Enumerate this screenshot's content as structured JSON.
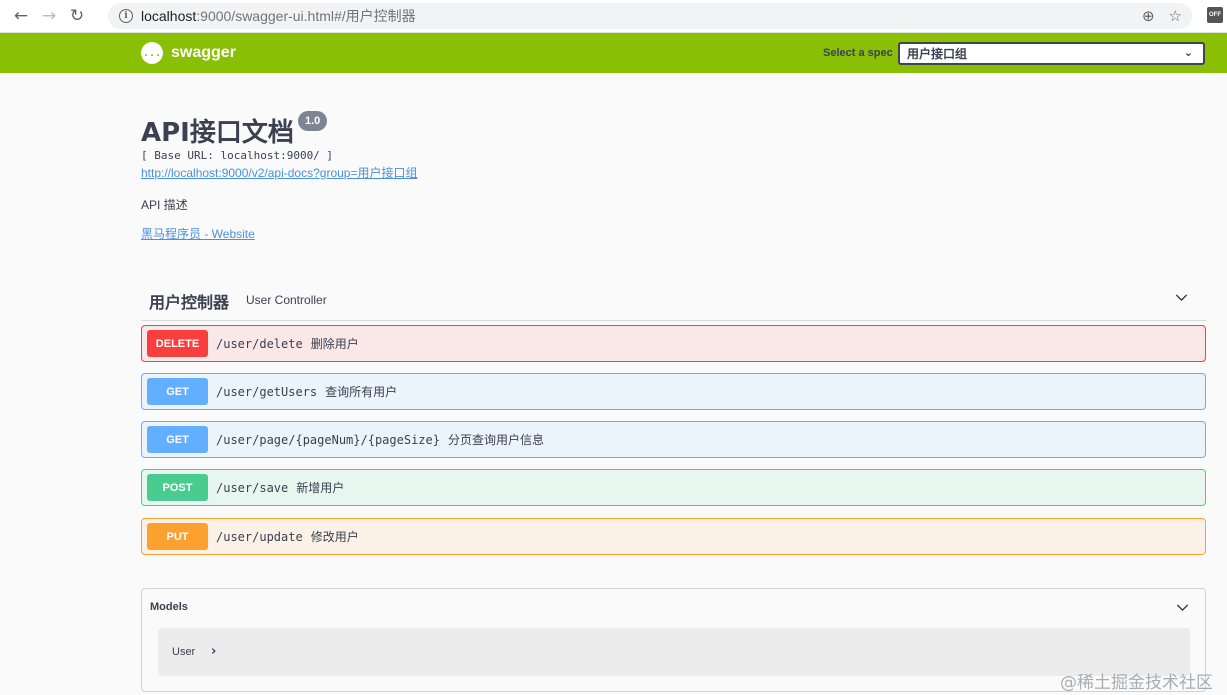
{
  "browser": {
    "back_icon": "←",
    "forward_icon": "→",
    "reload_icon": "↻",
    "url_host": "localhost",
    "url_path": ":9000/swagger-ui.html#/用户控制器",
    "zoom_icon": "⊕",
    "star_icon": "☆",
    "extension_label": "OFF"
  },
  "topbar": {
    "logo_glyph": "{...}",
    "logo_text": "swagger",
    "spec_label": "Select a spec",
    "spec_value": "用户接口组",
    "color": "#89bf04"
  },
  "info": {
    "title": "API接口文档",
    "version": "1.0",
    "base_url": "[ Base URL: localhost:9000/ ]",
    "docs_link": "http://localhost:9000/v2/api-docs?group=用户接口组",
    "description": "API 描述",
    "website_link": "黑马程序员 - Website"
  },
  "tag": {
    "name": "用户控制器",
    "description": "User Controller"
  },
  "operations": [
    {
      "method": "DELETE",
      "path": "/user/delete",
      "summary": "删除用户",
      "color": "#f93e3e"
    },
    {
      "method": "GET",
      "path": "/user/getUsers",
      "summary": "查询所有用户",
      "color": "#61affe"
    },
    {
      "method": "GET",
      "path": "/user/page/{pageNum}/{pageSize}",
      "summary": "分页查询用户信息",
      "color": "#61affe"
    },
    {
      "method": "POST",
      "path": "/user/save",
      "summary": "新增用户",
      "color": "#49cc90"
    },
    {
      "method": "PUT",
      "path": "/user/update",
      "summary": "修改用户",
      "color": "#fca130"
    }
  ],
  "models": {
    "title": "Models",
    "items": [
      {
        "name": "User",
        "arrow": "›"
      }
    ]
  },
  "watermark": "@稀土掘金技术社区"
}
